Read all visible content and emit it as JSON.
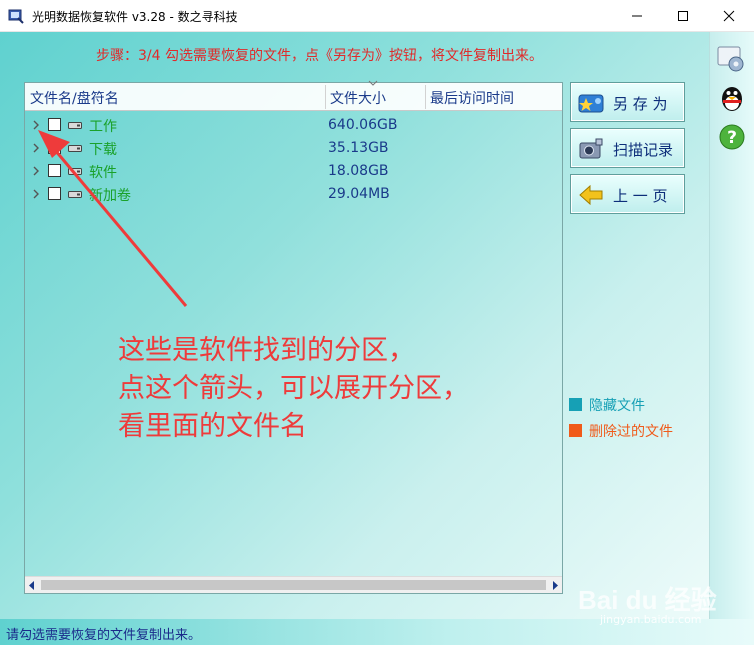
{
  "window": {
    "title": "光明数据恢复软件 v3.28 - 数之寻科技",
    "controls": [
      "minimize-icon",
      "maximize-icon",
      "close-icon"
    ]
  },
  "step": "步骤：3/4 勾选需要恢复的文件，点《另存为》按钮，将文件复制出来。",
  "list": {
    "columns": [
      "文件名/盘符名",
      "文件大小",
      "最后访问时间"
    ],
    "rows": [
      {
        "name": "工作",
        "size": "640.06GB",
        "time": "",
        "checked": false
      },
      {
        "name": "下载",
        "size": "35.13GB",
        "time": "",
        "checked": false
      },
      {
        "name": "软件",
        "size": "18.08GB",
        "time": "",
        "checked": false
      },
      {
        "name": "新加卷",
        "size": "29.04MB",
        "time": "",
        "checked": false
      }
    ]
  },
  "buttons": {
    "save_as": "另 存 为",
    "scan_log": "扫描记录",
    "prev_page": "上 一 页"
  },
  "legend": {
    "hidden": {
      "label": "隐藏文件",
      "color": "#16a0b5"
    },
    "deleted": {
      "label": "删除过的文件",
      "color": "#f05a1a"
    }
  },
  "annotation": {
    "line1": "这些是软件找到的分区，",
    "line2": "点这个箭头，可以展开分区，",
    "line3": "看里面的文件名"
  },
  "status": "请勾选需要恢复的文件复制出来。",
  "watermark": {
    "text": "Bai du 经验",
    "sub": "jingyan.baidu.com"
  },
  "colors": {
    "accent": "#5fd1cf",
    "annotation": "#ee3b3b",
    "partition_name": "#1aa12a"
  }
}
